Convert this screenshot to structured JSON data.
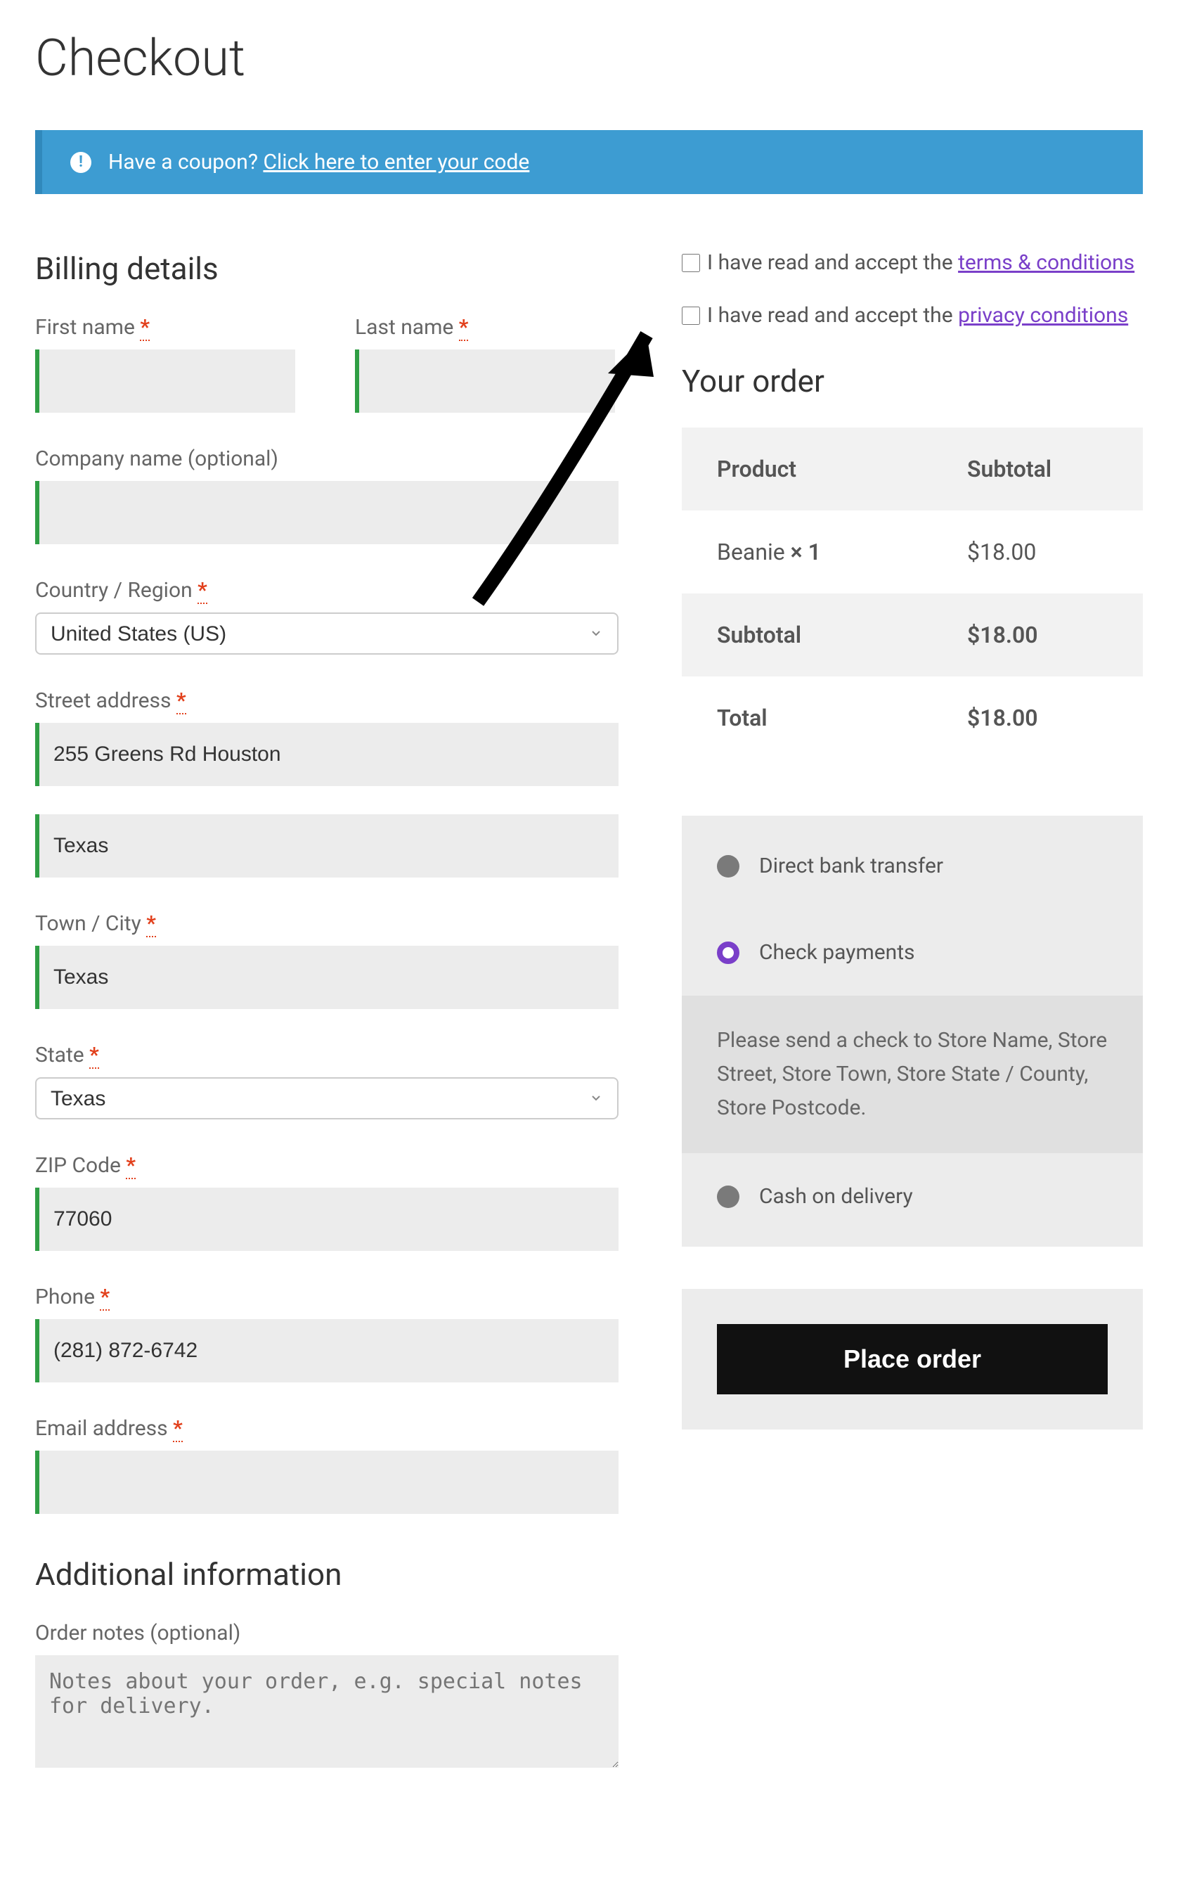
{
  "page_title": "Checkout",
  "coupon": {
    "prompt": "Have a coupon? ",
    "link_text": "Click here to enter your code"
  },
  "billing": {
    "heading": "Billing details",
    "first_name_label": "First name ",
    "first_name_value": "",
    "last_name_label": "Last name ",
    "last_name_value": "",
    "company_label": "Company name (optional)",
    "company_value": "",
    "country_label": "Country / Region ",
    "country_value": "United States (US)",
    "street_label": "Street address ",
    "street1_value": "255 Greens Rd Houston",
    "street2_value": "Texas",
    "city_label": "Town / City ",
    "city_value": "Texas",
    "state_label": "State ",
    "state_value": "Texas",
    "zip_label": "ZIP Code ",
    "zip_value": "77060",
    "phone_label": "Phone ",
    "phone_value": "(281) 872-6742",
    "email_label": "Email address ",
    "email_value": ""
  },
  "additional": {
    "heading": "Additional information",
    "notes_label": "Order notes (optional)",
    "notes_placeholder": "Notes about your order, e.g. special notes for delivery."
  },
  "accept": {
    "terms_text": "I have read and accept the ",
    "terms_link": "terms & conditions",
    "privacy_text": "I have read and accept the ",
    "privacy_link": "privacy conditions"
  },
  "order": {
    "heading": "Your order",
    "header_product": "Product",
    "header_subtotal": "Subtotal",
    "item_name": "Beanie  ",
    "item_qty": "× 1",
    "item_price": "$18.00",
    "subtotal_label": "Subtotal",
    "subtotal_value": "$18.00",
    "total_label": "Total",
    "total_value": "$18.00"
  },
  "payment": {
    "bank_transfer": "Direct bank transfer",
    "check_payments": "Check payments",
    "check_description": "Please send a check to Store Name, Store Street, Store Town, Store State / County, Store Postcode.",
    "cash_on_delivery": "Cash on delivery"
  },
  "place_order_label": "Place order",
  "required_marker": "*"
}
